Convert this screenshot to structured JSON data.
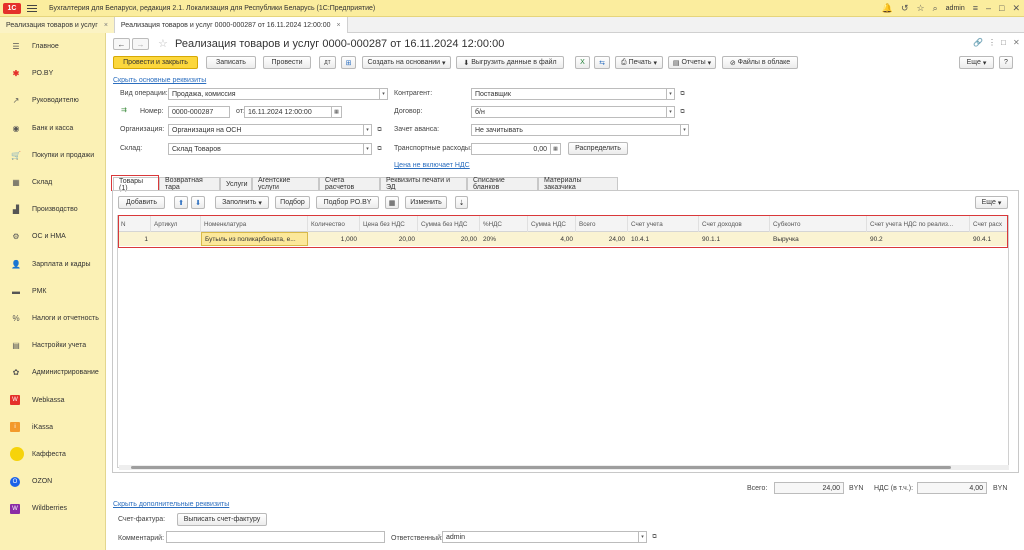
{
  "topbar": {
    "logo": "1С",
    "title": "Бухгалтерия для Беларуси, редакция 2.1. Локализация для Республики Беларусь  (1С:Предприятие)",
    "user": "admin"
  },
  "window_tabs": [
    {
      "label": "Реализация товаров и услуг",
      "active": false
    },
    {
      "label": "Реализация товаров и услуг 0000-000287 от 16.11.2024 12:00:00",
      "active": true
    }
  ],
  "sidebar": {
    "items": [
      {
        "label": "Главное",
        "icon": "menu-icon"
      },
      {
        "label": "РО.BY",
        "icon": "ro-icon"
      },
      {
        "label": "Руководителю",
        "icon": "chart-icon"
      },
      {
        "label": "Банк и касса",
        "icon": "bank-icon"
      },
      {
        "label": "Покупки и продажи",
        "icon": "cart-icon"
      },
      {
        "label": "Склад",
        "icon": "warehouse-icon"
      },
      {
        "label": "Производство",
        "icon": "factory-icon"
      },
      {
        "label": "ОС и НМА",
        "icon": "assets-icon"
      },
      {
        "label": "Зарплата и кадры",
        "icon": "person-icon"
      },
      {
        "label": "РМК",
        "icon": "cashier-icon"
      },
      {
        "label": "Налоги и отчетность",
        "icon": "tax-icon"
      },
      {
        "label": "Настройки учета",
        "icon": "settings-icon"
      },
      {
        "label": "Администрирование",
        "icon": "gear-icon"
      },
      {
        "label": "Webkassa",
        "icon": "webkassa-icon"
      },
      {
        "label": "iKassa",
        "icon": "ikassa-icon"
      },
      {
        "label": "Каффеста",
        "icon": "kaffesta-icon"
      },
      {
        "label": "OZON",
        "icon": "ozon-icon"
      },
      {
        "label": "Wildberries",
        "icon": "wildberries-icon"
      }
    ]
  },
  "document": {
    "title": "Реализация товаров и услуг 0000-000287 от 16.11.2024 12:00:00",
    "toolbar": {
      "post_close": "Провести и закрыть",
      "save": "Записать",
      "post": "Провести",
      "create_based": "Создать на основании",
      "export": "Выгрузить данные в файл",
      "print": "Печать",
      "reports": "Отчеты",
      "cloud_files": "Файлы в облаке",
      "more": "Еще"
    },
    "hide_main_link": "Скрыть основные реквизиты",
    "fields": {
      "operation_label": "Вид операции:",
      "operation_value": "Продажа, комиссия",
      "number_label": "Номер:",
      "number_value": "0000-000287",
      "date_label": "от:",
      "date_value": "16.11.2024 12:00:00",
      "org_label": "Организация:",
      "org_value": "Организация на ОСН",
      "warehouse_label": "Склад:",
      "warehouse_value": "Склад Товаров",
      "counterparty_label": "Контрагент:",
      "counterparty_value": "Поставщик",
      "contract_label": "Договор:",
      "contract_value": "б/н",
      "advance_label": "Зачет аванса:",
      "advance_value": "Не зачитывать",
      "transport_label": "Транспортные расходы:",
      "transport_value": "0,00",
      "distribute": "Распределить",
      "vat_link": "Цена не включает НДС"
    },
    "tabs": [
      "Товары (1)",
      "Возвратная тара",
      "Услуги",
      "Агентские услуги",
      "Счета расчетов",
      "Реквизиты печати и ЭД",
      "Списание бланков",
      "Материалы заказчика"
    ],
    "table_toolbar": {
      "add": "Добавить",
      "fill": "Заполнить",
      "selection": "Подбор",
      "selection_ro": "Подбор РО.BY",
      "change": "Изменить",
      "more": "Еще"
    },
    "columns": [
      "N",
      "Артикул",
      "Номенклатура",
      "Количество",
      "Цена без НДС",
      "Сумма без НДС",
      "%НДС",
      "Сумма НДС",
      "Всего",
      "Счет учета",
      "Счет доходов",
      "Субконто",
      "Счет учета НДС по реализ...",
      "Счет расх"
    ],
    "rows": [
      [
        "1",
        "",
        "Бутыль из поликарбоната, е...",
        "1,000",
        "20,00",
        "20,00",
        "20%",
        "4,00",
        "24,00",
        "10.4.1",
        "90.1.1",
        "Выручка",
        "90.2",
        "90.4.1"
      ]
    ],
    "totals": {
      "total_label": "Всего:",
      "total_value": "24,00",
      "currency": "BYN",
      "vat_label": "НДС (в т.ч.):",
      "vat_value": "4,00",
      "vat_currency": "BYN"
    },
    "footer": {
      "extra_link": "Скрыть дополнительные реквизиты",
      "invoice_label": "Счет-фактура:",
      "invoice_button": "Выписать счет-фактуру",
      "comment_label": "Комментарий:",
      "comment_value": "",
      "responsible_label": "Ответственный:",
      "responsible_value": "admin"
    }
  }
}
